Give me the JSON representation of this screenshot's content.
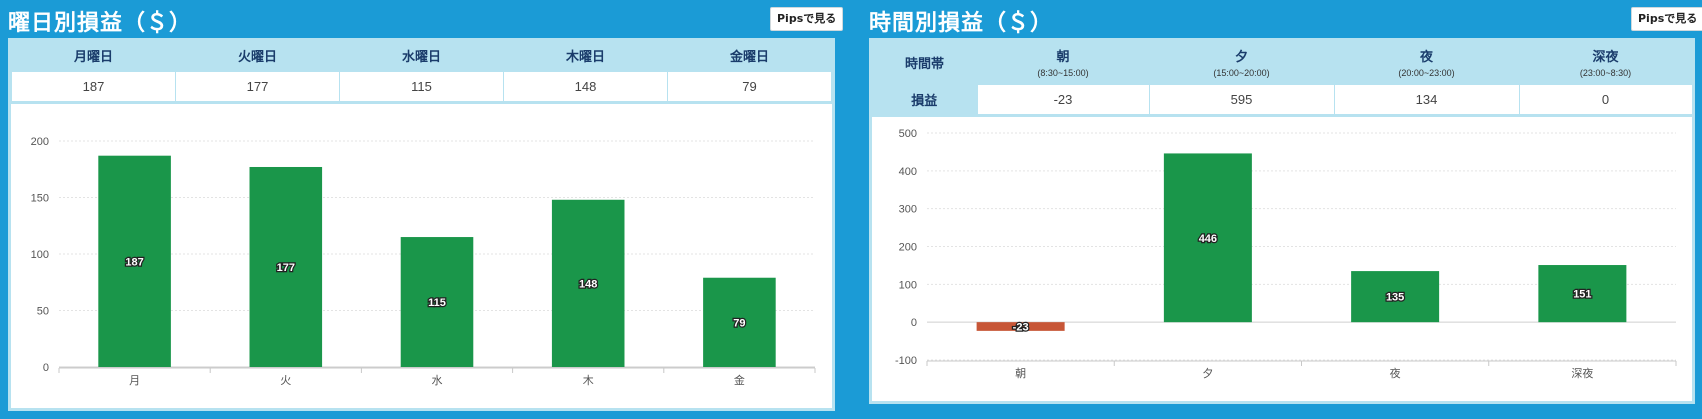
{
  "left": {
    "title": "曜日別損益（＄）",
    "pips_button": "Pipsで見る",
    "table": {
      "headers": [
        "月曜日",
        "火曜日",
        "水曜日",
        "木曜日",
        "金曜日"
      ],
      "values": [
        "187",
        "177",
        "115",
        "148",
        "79"
      ]
    }
  },
  "right": {
    "title": "時間別損益（＄）",
    "pips_button": "Pipsで見る",
    "table": {
      "corner_label": "時間帯",
      "row_label": "損益",
      "headers": [
        {
          "name": "朝",
          "range": "(8:30~15:00)"
        },
        {
          "name": "夕",
          "range": "(15:00~20:00)"
        },
        {
          "name": "夜",
          "range": "(20:00~23:00)"
        },
        {
          "name": "深夜",
          "range": "(23:00~8:30)"
        }
      ],
      "values": [
        "-23",
        "595",
        "134",
        "0"
      ]
    }
  },
  "chart_data": [
    {
      "type": "bar",
      "categories": [
        "月",
        "火",
        "水",
        "木",
        "金"
      ],
      "values": [
        187,
        177,
        115,
        148,
        79
      ],
      "ylim": [
        0,
        200
      ],
      "yticks": [
        0,
        50,
        100,
        150,
        200
      ],
      "grid": true,
      "colors": {
        "positive": "#1a964a",
        "negative": "#c75637"
      }
    },
    {
      "type": "bar",
      "categories": [
        "朝",
        "夕",
        "夜",
        "深夜"
      ],
      "values": [
        -23,
        446,
        135,
        151
      ],
      "ylim": [
        -100,
        500
      ],
      "yticks": [
        -100,
        0,
        100,
        200,
        300,
        400,
        500
      ],
      "grid": true,
      "colors": {
        "positive": "#1a964a",
        "negative": "#c75637"
      }
    }
  ]
}
